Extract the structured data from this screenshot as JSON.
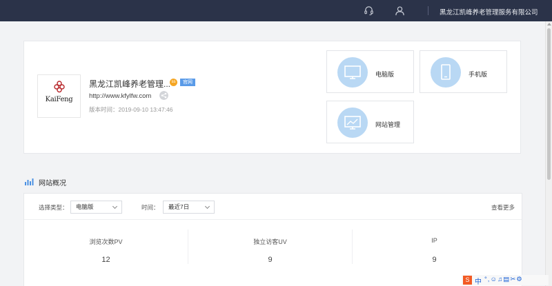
{
  "header": {
    "company_name": "黑龙江凯峰养老管理服务有限公司",
    "icons": [
      "headset-icon",
      "user-icon"
    ]
  },
  "site": {
    "name": "黑龙江凯峰养老管理...",
    "badge_ss": "ss",
    "badge_web": "官网",
    "url": "http://www.kfylfw.com",
    "time": "版本时间：2019-09-10 13:47:46",
    "logo_text": "KaiFeng"
  },
  "tiles": {
    "desktop": "电脑版",
    "mobile": "手机版",
    "manage": "网站管理"
  },
  "overview": {
    "title": "网站概况",
    "type_label": "选择类型：",
    "type_value": "电脑版",
    "time_label": "时间：",
    "time_value": "最近7日",
    "more": "查看更多",
    "stats": [
      {
        "label": "浏览次数PV",
        "value": "12"
      },
      {
        "label": "独立访客UV",
        "value": "9"
      },
      {
        "label": "IP",
        "value": "9"
      }
    ]
  },
  "ime": {
    "logo": "S",
    "lang": "中",
    "tools": "°,☺♫▤✂⚙"
  },
  "colors": {
    "topbar": "#2b3349",
    "accent": "#5a9be8",
    "tile_circle": "#b9d8f4"
  }
}
